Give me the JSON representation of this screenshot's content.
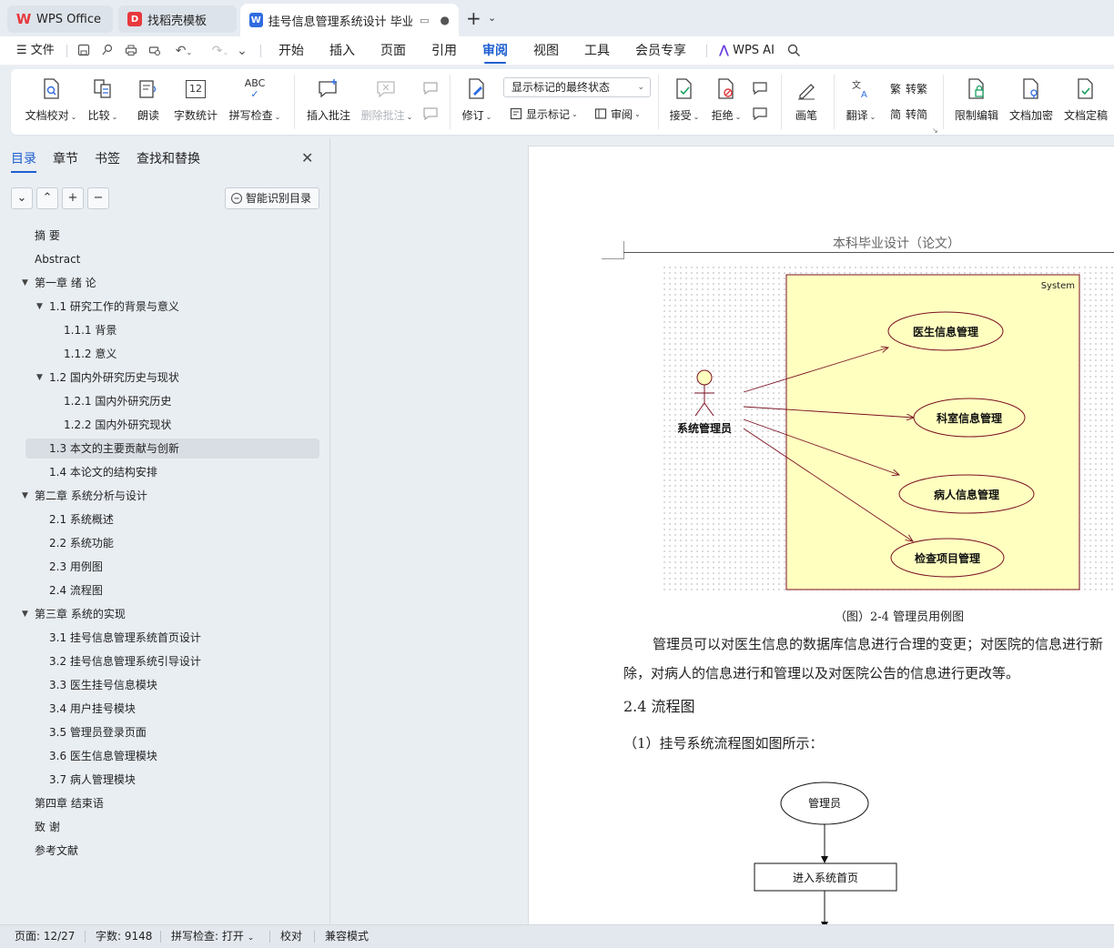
{
  "tabs": [
    {
      "label": "WPS Office",
      "icon": "wps-logo-icon",
      "color": "#e8383d"
    },
    {
      "label": "找稻壳模板",
      "icon": "docer-logo-icon",
      "color": "#e8383d"
    },
    {
      "label": "挂号信息管理系统设计 毕业论",
      "icon": "wps-writer-icon",
      "color": "#2f6be0"
    }
  ],
  "menu": {
    "file": "文件",
    "items": [
      "开始",
      "插入",
      "页面",
      "引用",
      "审阅",
      "视图",
      "工具",
      "会员专享"
    ],
    "active": "审阅",
    "ai": "WPS AI"
  },
  "ribbon": {
    "doc_check": "文档校对",
    "compare": "比较",
    "read_aloud": "朗读",
    "word_count": "字数统计",
    "spell_check": "拼写检查",
    "insert_comment": "插入批注",
    "delete_comment": "删除批注",
    "track_changes": "修订",
    "markup_state": "显示标记的最终状态",
    "show_markup": "显示标记",
    "review": "审阅",
    "accept": "接受",
    "reject": "拒绝",
    "pen": "画笔",
    "translate": "翻译",
    "to_traditional": "转繁",
    "to_simplified": "转简",
    "restrict_edit": "限制编辑",
    "encrypt": "文档加密",
    "finalize": "文档定稿",
    "icon_texts": {
      "word_count": "12",
      "spell_check": "ABC"
    }
  },
  "nav": {
    "tabs": [
      "目录",
      "章节",
      "书签",
      "查找和替换"
    ],
    "active_tab": "目录",
    "smart_toc": "智能识别目录",
    "toc": [
      {
        "text": "摘    要",
        "level": 0,
        "arrow": false
      },
      {
        "text": "Abstract",
        "level": 0,
        "arrow": false
      },
      {
        "text": "第一章  绪  论",
        "level": 0,
        "arrow": true
      },
      {
        "text": "1.1  研究工作的背景与意义",
        "level": 1,
        "arrow": true
      },
      {
        "text": "1.1.1 背景",
        "level": 2,
        "arrow": false
      },
      {
        "text": "1.1.2 意义",
        "level": 2,
        "arrow": false
      },
      {
        "text": "1.2  国内外研究历史与现状",
        "level": 1,
        "arrow": true
      },
      {
        "text": "1.2.1 国内外研究历史",
        "level": 2,
        "arrow": false
      },
      {
        "text": "1.2.2 国内外研究现状",
        "level": 2,
        "arrow": false
      },
      {
        "text": "1.3  本文的主要贡献与创新",
        "level": 1,
        "arrow": false,
        "selected": true
      },
      {
        "text": "1.4  本论文的结构安排",
        "level": 1,
        "arrow": false
      },
      {
        "text": "第二章  系统分析与设计",
        "level": 0,
        "arrow": true
      },
      {
        "text": "2.1  系统概述",
        "level": 1,
        "arrow": false
      },
      {
        "text": "2.2  系统功能",
        "level": 1,
        "arrow": false
      },
      {
        "text": "2.3  用例图",
        "level": 1,
        "arrow": false
      },
      {
        "text": "2.4  流程图",
        "level": 1,
        "arrow": false
      },
      {
        "text": "第三章  系统的实现",
        "level": 0,
        "arrow": true
      },
      {
        "text": "3.1  挂号信息管理系统首页设计",
        "level": 1,
        "arrow": false
      },
      {
        "text": "3.2  挂号信息管理系统引导设计",
        "level": 1,
        "arrow": false
      },
      {
        "text": "3.3  医生挂号信息模块",
        "level": 1,
        "arrow": false
      },
      {
        "text": "3.4  用户挂号模块",
        "level": 1,
        "arrow": false
      },
      {
        "text": "3.5  管理员登录页面",
        "level": 1,
        "arrow": false
      },
      {
        "text": "3.6  医生信息管理模块",
        "level": 1,
        "arrow": false
      },
      {
        "text": "3.7  病人管理模块",
        "level": 1,
        "arrow": false
      },
      {
        "text": "第四章  结束语",
        "level": 0,
        "arrow": false
      },
      {
        "text": "致      谢",
        "level": 0,
        "arrow": false
      },
      {
        "text": "参考文献",
        "level": 0,
        "arrow": false
      }
    ]
  },
  "document": {
    "header": "本科毕业设计（论文）",
    "usecase": {
      "system_label": "System",
      "actor": "系统管理员",
      "cases": [
        "医生信息管理",
        "科室信息管理",
        "病人信息管理",
        "检查项目管理"
      ]
    },
    "caption": "（图）2-4  管理员用例图",
    "para_line1": "管理员可以对医生信息的数据库信息进行合理的变更；对医院的信息进行新",
    "para_line2": "除，对病人的信息进行和管理以及对医院公告的信息进行更改等。",
    "section": "2.4  流程图",
    "flow_intro": "（1）挂号系统流程图如图所示：",
    "flow": {
      "start": "管理员",
      "step1": "进入系统首页"
    }
  },
  "status": {
    "page": "页面: 12/27",
    "words": "字数: 9148",
    "spell": "拼写检查: 打开",
    "proof": "校对",
    "compat": "兼容模式"
  },
  "colors": {
    "accent": "#1f5fd0",
    "usecase_fill": "#ffffc0",
    "usecase_arrow": "#7a1020"
  }
}
